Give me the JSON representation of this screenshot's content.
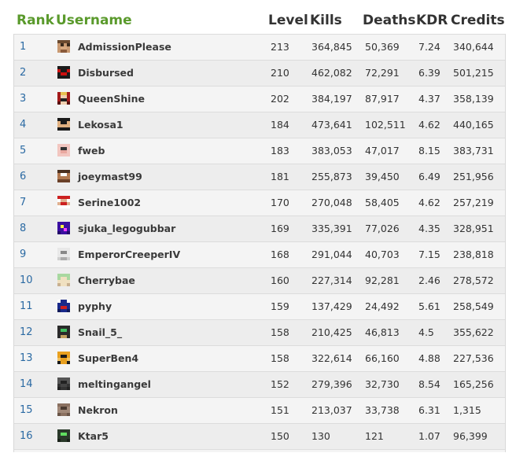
{
  "columns": {
    "rank": "Rank",
    "username": "Username",
    "level": "Level",
    "kills": "Kills",
    "deaths": "Deaths",
    "kdr": "KDR",
    "credits": "Credits"
  },
  "rows": [
    {
      "rank": "1",
      "username": "AdmissionPlease",
      "level": "213",
      "kills": "364,845",
      "deaths": "50,369",
      "kdr": "7.24",
      "credits": "340,644",
      "avatar": [
        "#6b4a2f",
        "#6b4a2f",
        "#6b4a2f",
        "#6b4a2f",
        "#c99a72",
        "#3a2a1c",
        "#c99a72",
        "#3a2a1c",
        "#c99a72",
        "#d8aa80",
        "#d8aa80",
        "#c99a72",
        "#c99a72",
        "#8a5a3a",
        "#8a5a3a",
        "#c99a72"
      ]
    },
    {
      "rank": "2",
      "username": "Disbursed",
      "level": "210",
      "kills": "462,082",
      "deaths": "72,291",
      "kdr": "6.39",
      "credits": "501,215",
      "avatar": [
        "#1a1a1a",
        "#1a1a1a",
        "#1a1a1a",
        "#1a1a1a",
        "#cc1010",
        "#1a1a1a",
        "#1a1a1a",
        "#cc1010",
        "#1a1a1a",
        "#cc1010",
        "#cc1010",
        "#1a1a1a",
        "#1a1a1a",
        "#1a1a1a",
        "#1a1a1a",
        "#1a1a1a"
      ]
    },
    {
      "rank": "3",
      "username": "QueenShine",
      "level": "202",
      "kills": "384,197",
      "deaths": "87,917",
      "kdr": "4.37",
      "credits": "358,139",
      "avatar": [
        "#a31a1a",
        "#e8c050",
        "#e8c050",
        "#a31a1a",
        "#a31a1a",
        "#f0d0b0",
        "#f0d0b0",
        "#a31a1a",
        "#a31a1a",
        "#222222",
        "#222222",
        "#a31a1a",
        "#5a0f0f",
        "#f0d0b0",
        "#f0d0b0",
        "#5a0f0f"
      ]
    },
    {
      "rank": "4",
      "username": "Lekosa1",
      "level": "184",
      "kills": "473,641",
      "deaths": "102,511",
      "kdr": "4.62",
      "credits": "440,165",
      "avatar": [
        "#1a1a1a",
        "#1a1a1a",
        "#1a1a1a",
        "#1a1a1a",
        "#e0b080",
        "#1a1a1a",
        "#1a1a1a",
        "#e0b080",
        "#e0b080",
        "#e0b080",
        "#e0b080",
        "#e0b080",
        "#1a1a1a",
        "#1a1a1a",
        "#1a1a1a",
        "#1a1a1a"
      ]
    },
    {
      "rank": "5",
      "username": "fweb",
      "level": "183",
      "kills": "383,053",
      "deaths": "47,017",
      "kdr": "8.15",
      "credits": "383,731",
      "avatar": [
        "#f2c6c0",
        "#f2c6c0",
        "#f2c6c0",
        "#f2c6c0",
        "#f2c6c0",
        "#333333",
        "#333333",
        "#f2c6c0",
        "#f2c6c0",
        "#e9a8a0",
        "#e9a8a0",
        "#f2c6c0",
        "#f2c6c0",
        "#f2c6c0",
        "#f2c6c0",
        "#f2c6c0"
      ]
    },
    {
      "rank": "6",
      "username": "joeymast99",
      "level": "181",
      "kills": "255,873",
      "deaths": "39,450",
      "kdr": "6.49",
      "credits": "251,956",
      "avatar": [
        "#4a3020",
        "#4a3020",
        "#4a3020",
        "#4a3020",
        "#b07850",
        "#ffffff",
        "#ffffff",
        "#b07850",
        "#b07850",
        "#b07850",
        "#b07850",
        "#b07850",
        "#6a4028",
        "#6a4028",
        "#6a4028",
        "#6a4028"
      ]
    },
    {
      "rank": "7",
      "username": "Serine1002",
      "level": "170",
      "kills": "270,048",
      "deaths": "58,405",
      "kdr": "4.62",
      "credits": "257,219",
      "avatar": [
        "#cc2020",
        "#cc2020",
        "#cc2020",
        "#cc2020",
        "#ffffff",
        "#e0b090",
        "#e0b090",
        "#ffffff",
        "#e0b090",
        "#cc2020",
        "#cc2020",
        "#e0b090",
        "#ffffff",
        "#ffffff",
        "#ffffff",
        "#ffffff"
      ]
    },
    {
      "rank": "8",
      "username": "sjuka_legogubbar",
      "level": "169",
      "kills": "335,391",
      "deaths": "77,026",
      "kdr": "4.35",
      "credits": "328,951",
      "avatar": [
        "#3a10a0",
        "#3a10a0",
        "#3a10a0",
        "#3a10a0",
        "#3a10a0",
        "#ffff40",
        "#3a10a0",
        "#3a10a0",
        "#3a10a0",
        "#3a10a0",
        "#ff40ff",
        "#3a10a0",
        "#22086a",
        "#3a10a0",
        "#3a10a0",
        "#22086a"
      ]
    },
    {
      "rank": "9",
      "username": "EmperorCreeperIV",
      "level": "168",
      "kills": "291,044",
      "deaths": "40,703",
      "kdr": "7.15",
      "credits": "238,818",
      "avatar": [
        "#e8e8e8",
        "#e8e8e8",
        "#e8e8e8",
        "#e8e8e8",
        "#e8e8e8",
        "#888888",
        "#888888",
        "#e8e8e8",
        "#e8e8e8",
        "#e8e8e8",
        "#e8e8e8",
        "#e8e8e8",
        "#cfcfcf",
        "#aaaaaa",
        "#aaaaaa",
        "#cfcfcf"
      ]
    },
    {
      "rank": "10",
      "username": "Cherrybae",
      "level": "160",
      "kills": "227,314",
      "deaths": "92,281",
      "kdr": "2.46",
      "credits": "278,572",
      "avatar": [
        "#a8d8a0",
        "#a8d8a0",
        "#a8d8a0",
        "#a8d8a0",
        "#a8d8a0",
        "#f0e0c0",
        "#f0e0c0",
        "#a8d8a0",
        "#f0e0c0",
        "#f0e0c0",
        "#f0e0c0",
        "#f0e0c0",
        "#c8b090",
        "#f0e0c0",
        "#f0e0c0",
        "#c8b090"
      ]
    },
    {
      "rank": "11",
      "username": "pyphy",
      "level": "159",
      "kills": "137,429",
      "deaths": "24,492",
      "kdr": "5.61",
      "credits": "258,549",
      "avatar": [
        "#ffffff",
        "#1a2a8a",
        "#1a2a8a",
        "#ffffff",
        "#1a2a8a",
        "#1a2a8a",
        "#1a2a8a",
        "#1a2a8a",
        "#1a2a8a",
        "#cc2020",
        "#cc2020",
        "#1a2a8a",
        "#101a5a",
        "#1a2a8a",
        "#1a2a8a",
        "#101a5a"
      ]
    },
    {
      "rank": "12",
      "username": "Snail_5_",
      "level": "158",
      "kills": "210,425",
      "deaths": "46,813",
      "kdr": "4.5",
      "credits": "355,622",
      "avatar": [
        "#2a2a2a",
        "#2a2a2a",
        "#2a2a2a",
        "#2a2a2a",
        "#2a2a2a",
        "#40c060",
        "#40c060",
        "#2a2a2a",
        "#2a2a2a",
        "#2a2a2a",
        "#2a2a2a",
        "#2a2a2a",
        "#2a2a2a",
        "#c0a060",
        "#c0a060",
        "#2a2a2a"
      ]
    },
    {
      "rank": "13",
      "username": "SuperBen4",
      "level": "158",
      "kills": "322,614",
      "deaths": "66,160",
      "kdr": "4.88",
      "credits": "227,536",
      "avatar": [
        "#e8a020",
        "#e8a020",
        "#e8a020",
        "#e8a020",
        "#e8a020",
        "#1a1a1a",
        "#1a1a1a",
        "#e8a020",
        "#f0c060",
        "#e8a020",
        "#e8a020",
        "#f0c060",
        "#1a1a1a",
        "#e8a020",
        "#e8a020",
        "#1a1a1a"
      ]
    },
    {
      "rank": "14",
      "username": "meltingangel",
      "level": "152",
      "kills": "279,396",
      "deaths": "32,730",
      "kdr": "8.54",
      "credits": "165,256",
      "avatar": [
        "#555555",
        "#555555",
        "#555555",
        "#555555",
        "#555555",
        "#222222",
        "#222222",
        "#555555",
        "#333333",
        "#444444",
        "#444444",
        "#333333",
        "#222222",
        "#333333",
        "#333333",
        "#222222"
      ]
    },
    {
      "rank": "15",
      "username": "Nekron",
      "level": "151",
      "kills": "213,037",
      "deaths": "33,738",
      "kdr": "6.31",
      "credits": "1,315",
      "avatar": [
        "#8a7060",
        "#8a7060",
        "#8a7060",
        "#8a7060",
        "#a08878",
        "#4a3a30",
        "#4a3a30",
        "#a08878",
        "#a08878",
        "#a08878",
        "#a08878",
        "#a08878",
        "#6a5548",
        "#8a7060",
        "#8a7060",
        "#6a5548"
      ]
    },
    {
      "rank": "16",
      "username": "Ktar5",
      "level": "150",
      "kills": "130",
      "deaths": "121",
      "kdr": "1.07",
      "credits": "96,399",
      "avatar": [
        "#2a3a2a",
        "#2a3a2a",
        "#2a3a2a",
        "#2a3a2a",
        "#2a3a2a",
        "#60e060",
        "#60e060",
        "#2a3a2a",
        "#2a3a2a",
        "#2a3a2a",
        "#2a3a2a",
        "#2a3a2a",
        "#1a221a",
        "#2a3a2a",
        "#2a3a2a",
        "#1a221a"
      ]
    }
  ]
}
